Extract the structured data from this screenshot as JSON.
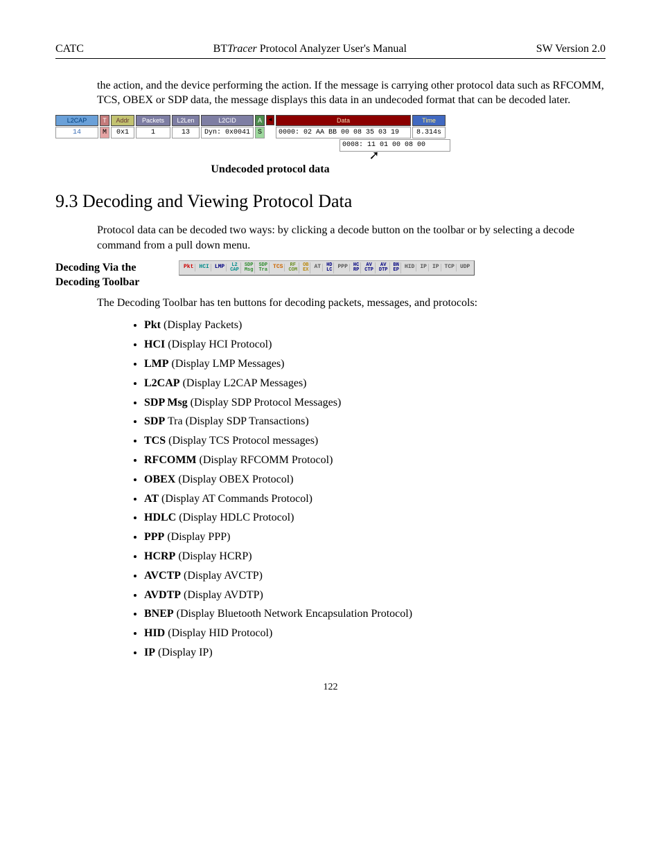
{
  "header": {
    "left": "CATC",
    "center_pre": "BT",
    "center_italic": "Tracer",
    "center_post": " Protocol Analyzer User's Manual",
    "right": "SW Version 2.0"
  },
  "intro_para": "the action, and the device performing the action.  If the message is carrying other protocol data such as RFCOMM, TCS, OBEX or SDP data, the message displays this data in an undecoded format that can be decoded later.",
  "packet": {
    "cols": {
      "l2cap_h": "L2CAP",
      "l2cap_v": "14",
      "t_h": "T",
      "t_v": "M",
      "addr_h": "Addr",
      "addr_v": "0x1",
      "packets_h": "Packets",
      "packets_v": "1",
      "l2len_h": "L2Len",
      "l2len_v": "13",
      "l2cid_h": "L2CID",
      "l2cid_v": "Dyn: 0x0041",
      "a_h": "A",
      "a_v": "S",
      "arrow_h": "◄",
      "data_h": "Data",
      "data_v1": "0000: 02 AA BB 00 08 35 03 19",
      "data_v2": "0008: 11 01 00 08 00",
      "time_h": "Time",
      "time_v": "8.314s"
    }
  },
  "fig_caption": "Undecoded protocol data",
  "section_heading": "9.3  Decoding and Viewing Protocol Data",
  "para_under_heading": "Protocol data can be decoded two ways:  by clicking a decode button on the toolbar or by selecting a decode command from a pull down menu.",
  "sidebar_label": "Decoding Via the Decoding Toolbar",
  "toolbar": [
    "Pkt",
    "HCI",
    "LMP",
    "L2\nCAP",
    "SDP\nMsg",
    "SDP\nTra",
    "TCS",
    "RF\nCOM",
    "OB\nEX",
    "AT",
    "HD\nLC",
    "PPP",
    "HC\nRP",
    "AV\nCTP",
    "AV\nDTP",
    "BN\nEP",
    "HID",
    "IP",
    "IP",
    "TCP",
    "UDP"
  ],
  "toolbar_para": "The Decoding Toolbar has ten buttons for decoding packets, messages, and protocols:",
  "list": [
    {
      "b": "Pkt",
      "rest": "  (Display Packets)"
    },
    {
      "b": "HCI",
      "rest": " (Display HCI Protocol)"
    },
    {
      "b": "LMP",
      "rest": " (Display LMP Messages)"
    },
    {
      "b": "L2CAP",
      "rest": " (Display L2CAP Messages)"
    },
    {
      "b": "SDP Msg",
      "rest": " (Display SDP Protocol Messages)"
    },
    {
      "b": "SDP",
      "rest": " Tra (Display SDP Transactions)"
    },
    {
      "b": "TCS",
      "rest": " (Display TCS Protocol messages)"
    },
    {
      "b": "RFCOMM",
      "rest": " (Display RFCOMM Protocol)"
    },
    {
      "b": "OBEX",
      "rest": "  (Display OBEX Protocol)"
    },
    {
      "b": "AT",
      "rest": " (Display AT Commands Protocol)"
    },
    {
      "b": "HDLC",
      "rest": " (Display HDLC Protocol)"
    },
    {
      "b": "PPP",
      "rest": " (Display PPP)"
    },
    {
      "b": "HCRP",
      "rest": " (Display HCRP)"
    },
    {
      "b": "AVCTP",
      "rest": " (Display AVCTP)"
    },
    {
      "b": "AVDTP",
      "rest": " (Display AVDTP)"
    },
    {
      "b": "BNEP",
      "rest": " (Display Bluetooth Network Encapsulation Protocol)"
    },
    {
      "b": "HID",
      "rest": " (Display HID Protocol)"
    },
    {
      "b": "IP",
      "rest": " (Display IP)"
    }
  ],
  "page_number": "122"
}
